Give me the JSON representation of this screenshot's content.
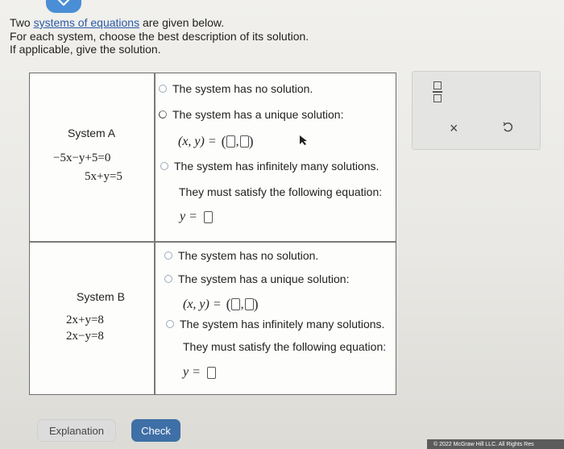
{
  "intro": {
    "line1_pre": "Two ",
    "line1_link": "systems of equations",
    "line1_post": " are given below.",
    "line2": "For each system, choose the best description of its solution.",
    "line3": "If applicable, give the solution."
  },
  "systemA": {
    "title": "System A",
    "eq1": "−5x−y+5=0",
    "eq2": "5x+y=5",
    "options": [
      "The system has no solution.",
      "The system has a unique solution:",
      "The system has infinitely many solutions."
    ],
    "tuple_label": "(x, y) =",
    "must_satisfy": "They must satisfy the following equation:",
    "y_label": "y ="
  },
  "systemB": {
    "title": "System B",
    "eq1": "2x+y=8",
    "eq2": "2x−y=8",
    "options": [
      "The system has no solution.",
      "The system has a unique solution:",
      "The system has infinitely many solutions."
    ],
    "tuple_label": "(x, y) =",
    "must_satisfy": "They must satisfy the following equation:",
    "y_label": "y ="
  },
  "buttons": {
    "explanation": "Explanation",
    "check": "Check"
  },
  "footer": "© 2022 McGraw Hill LLC. All Rights Res",
  "colors": {
    "accent": "#3e6fa6",
    "link": "#2b5aa8",
    "top_tab": "#4a8fd6"
  }
}
